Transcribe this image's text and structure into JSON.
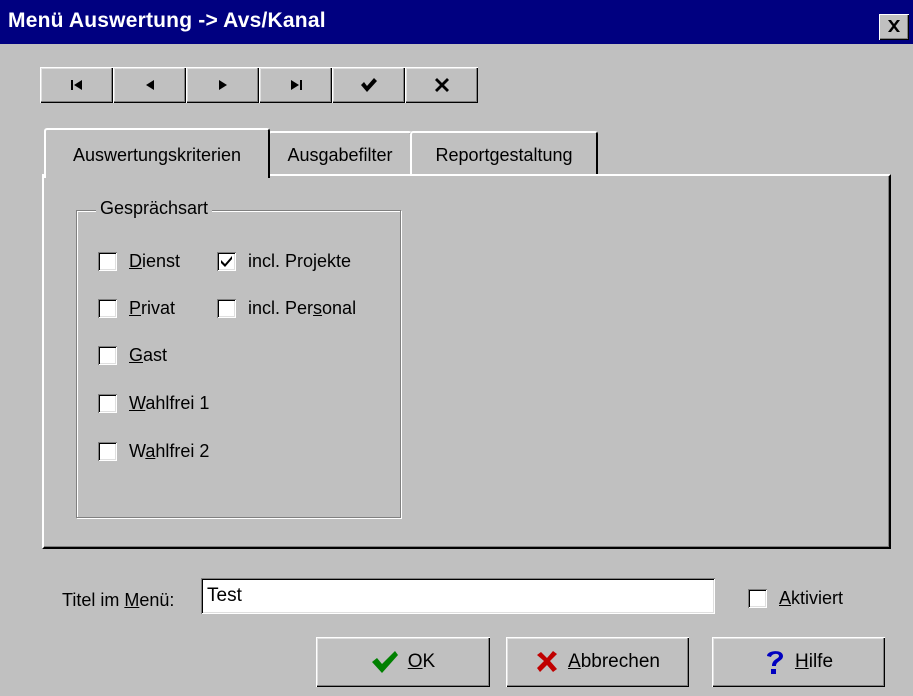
{
  "window": {
    "title": "Menü Auswertung -> Avs/Kanal"
  },
  "navigator": {
    "buttons": [
      "first-record-icon",
      "prior-record-icon",
      "next-record-icon",
      "last-record-icon",
      "post-checkmark-icon",
      "cancel-x-icon"
    ]
  },
  "tabs": [
    {
      "label": "Auswertungskriterien",
      "active": true
    },
    {
      "label": "Ausgabefilter",
      "active": false
    },
    {
      "label": "Reportgestaltung",
      "active": false
    }
  ],
  "group": {
    "legend": "Gesprächsart",
    "checkboxes": {
      "dienst": {
        "pre": "",
        "ul": "D",
        "post": "ienst",
        "checked": false
      },
      "incl_projekte": {
        "pre": "",
        "ul": "",
        "post": "incl. Projekte",
        "checked": true
      },
      "privat": {
        "pre": "",
        "ul": "P",
        "post": "rivat",
        "checked": false
      },
      "incl_personal": {
        "pre": "incl. Per",
        "ul": "s",
        "post": "onal",
        "checked": false
      },
      "gast": {
        "pre": "",
        "ul": "G",
        "post": "ast",
        "checked": false
      },
      "wahlfrei1": {
        "pre": "",
        "ul": "W",
        "post": "ahlfrei 1",
        "checked": false
      },
      "wahlfrei2": {
        "pre": "W",
        "ul": "a",
        "post": "hlfrei 2",
        "checked": false
      }
    }
  },
  "footer": {
    "title_label": {
      "pre": "Titel im ",
      "ul": "M",
      "post": "enü:"
    },
    "title_value": "Test",
    "aktiviert": {
      "ul": "A",
      "post": "ktiviert",
      "checked": false
    },
    "buttons": {
      "ok": {
        "ul": "O",
        "post": "K"
      },
      "abbrechen": {
        "ul": "A",
        "post": "bbrechen"
      },
      "hilfe": {
        "ul": "H",
        "post": "ilfe"
      }
    }
  },
  "colors": {
    "titlebar": "#000080",
    "face": "#c0c0c0",
    "ok_check": "#008000",
    "cancel_x": "#c00000",
    "help_q": "#0000c0"
  }
}
